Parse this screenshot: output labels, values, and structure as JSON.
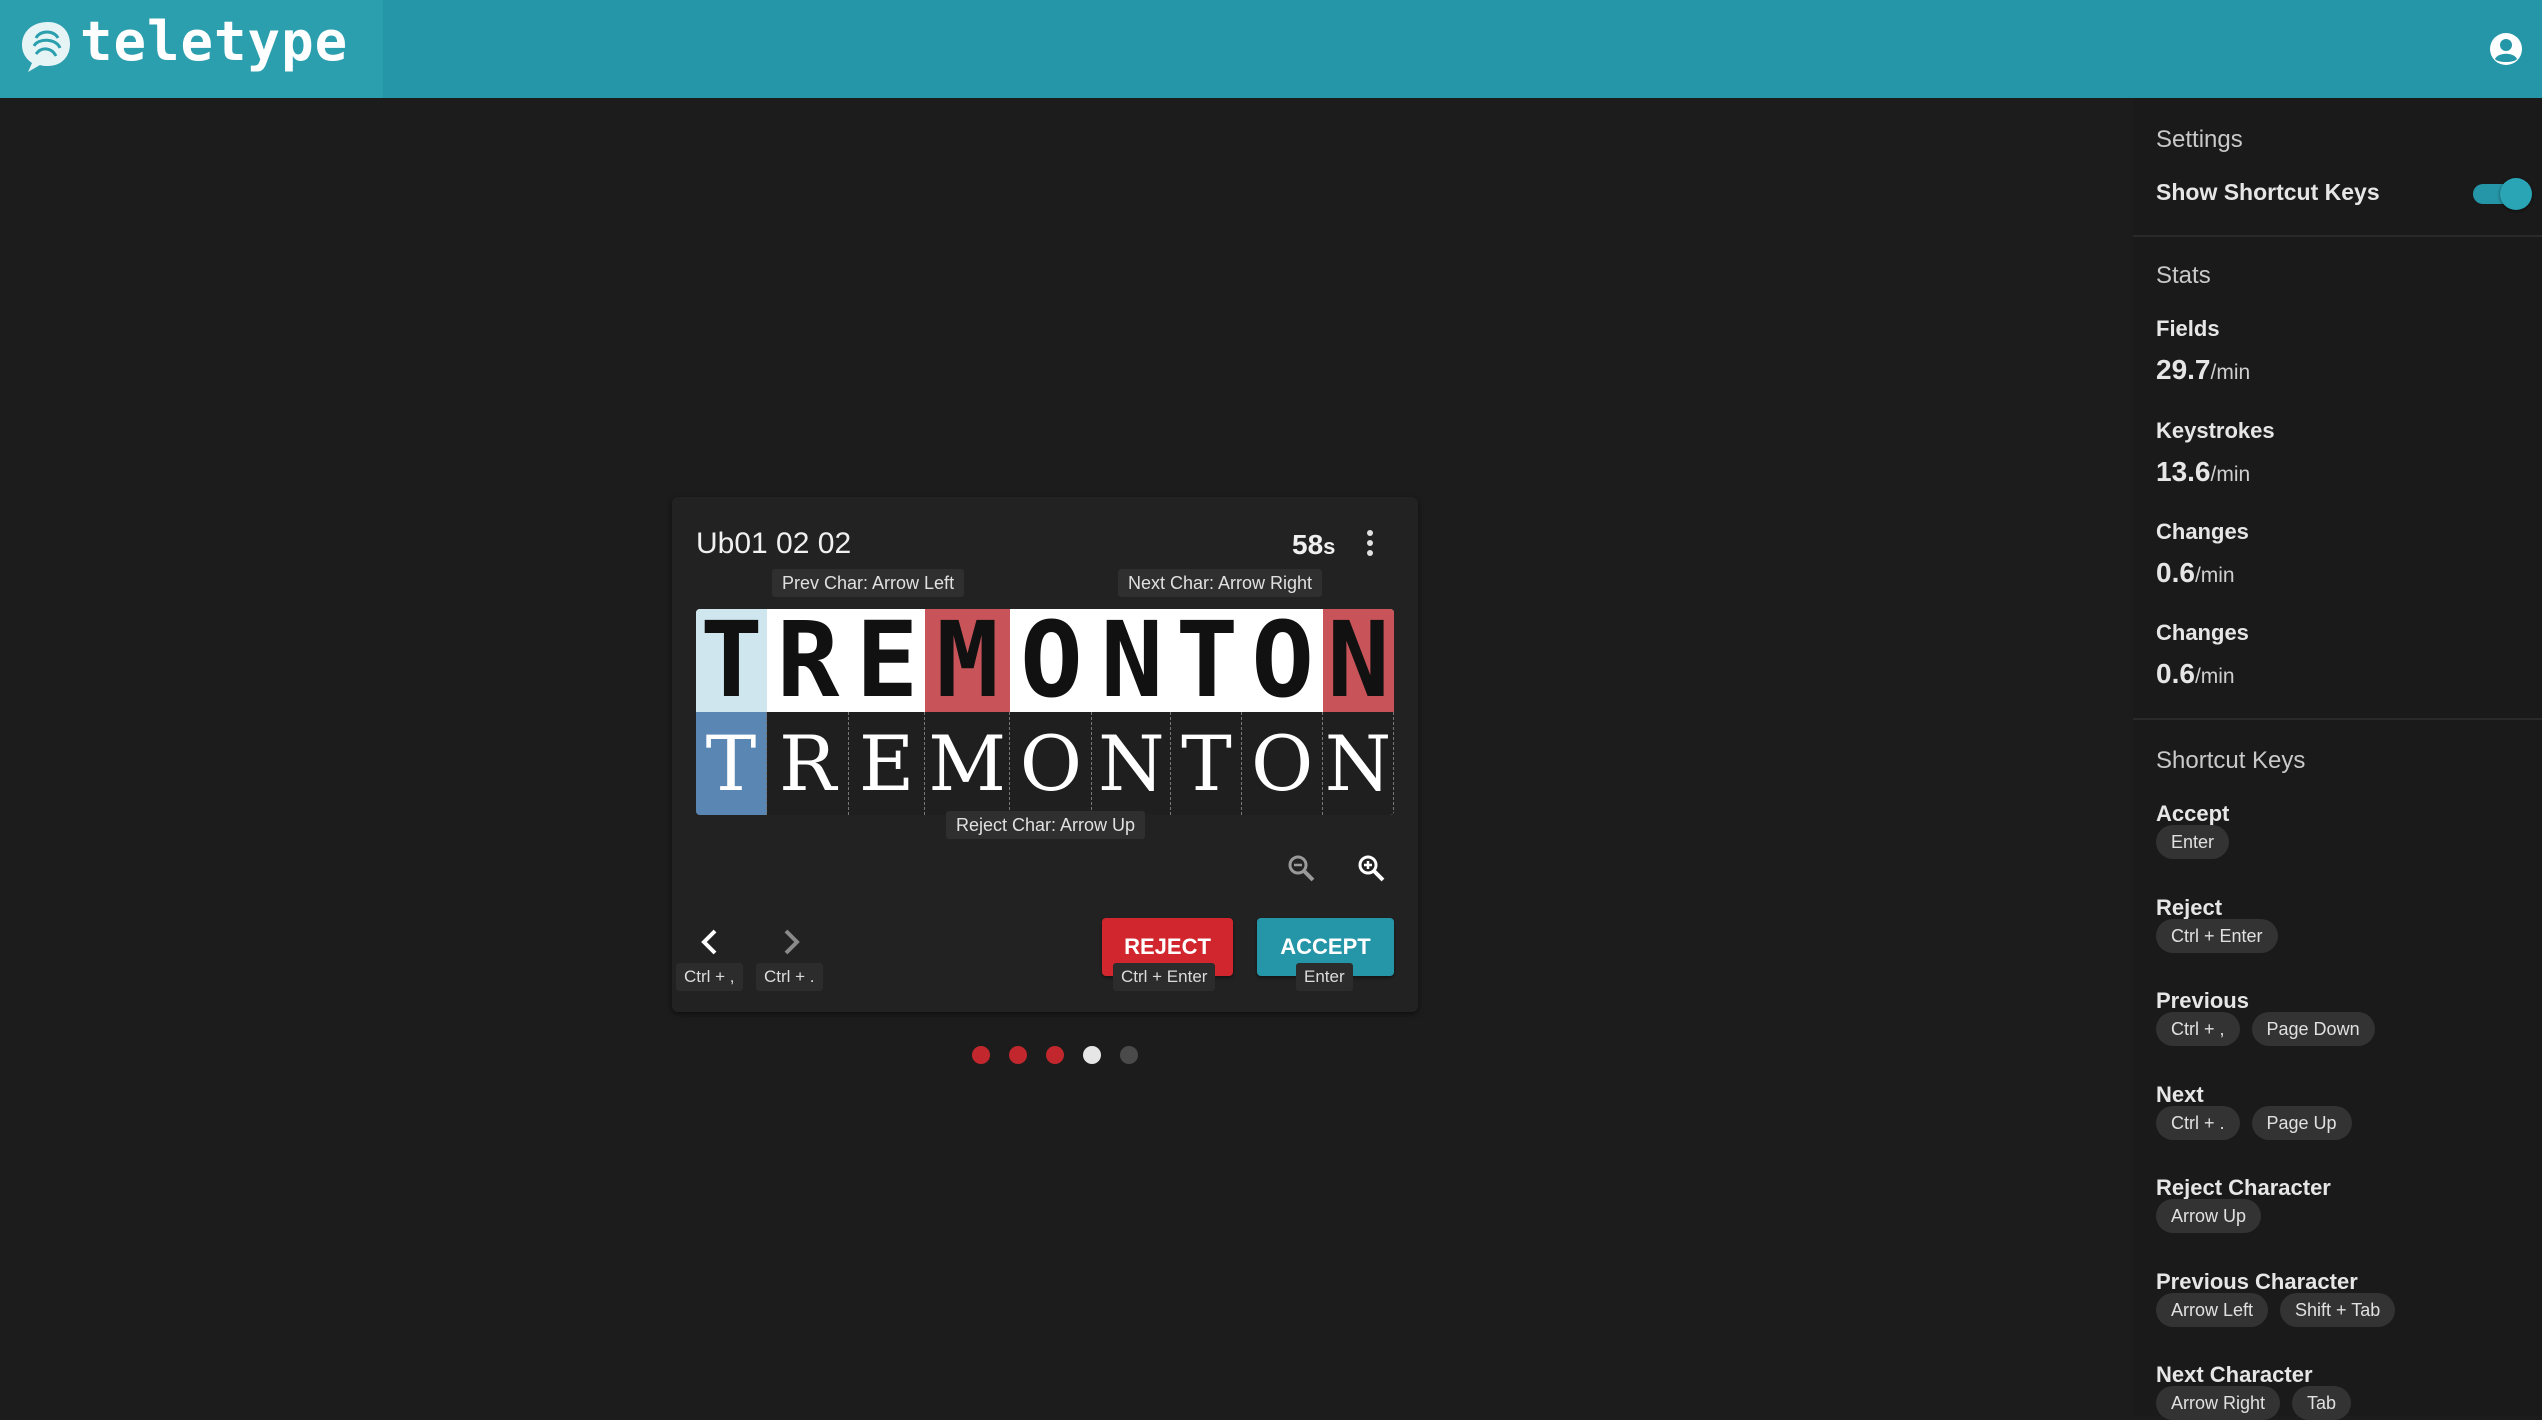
{
  "app": {
    "title": "teletype"
  },
  "settings": {
    "heading": "Settings",
    "show_shortcut_keys_label": "Show Shortcut Keys",
    "show_shortcut_keys_on": true
  },
  "stats": {
    "heading": "Stats",
    "items": [
      {
        "label": "Fields",
        "value": "29.7",
        "unit": "/min"
      },
      {
        "label": "Keystrokes",
        "value": "13.6",
        "unit": "/min"
      },
      {
        "label": "Changes",
        "value": "0.6",
        "unit": "/min"
      },
      {
        "label": "Changes",
        "value": "0.6",
        "unit": "/min"
      }
    ]
  },
  "shortcuts": {
    "heading": "Shortcut Keys",
    "items": [
      {
        "label": "Accept",
        "keys": [
          "Enter"
        ]
      },
      {
        "label": "Reject",
        "keys": [
          "Ctrl + Enter"
        ]
      },
      {
        "label": "Previous",
        "keys": [
          "Ctrl + ,",
          "Page Down"
        ]
      },
      {
        "label": "Next",
        "keys": [
          "Ctrl + .",
          "Page Up"
        ]
      },
      {
        "label": "Reject Character",
        "keys": [
          "Arrow Up"
        ]
      },
      {
        "label": "Previous Character",
        "keys": [
          "Arrow Left",
          "Shift + Tab"
        ]
      },
      {
        "label": "Next Character",
        "keys": [
          "Arrow Right",
          "Tab"
        ]
      }
    ]
  },
  "card": {
    "title": "Ub01 02 02",
    "timer_value": "58",
    "timer_unit": "s",
    "prev_char_tip": "Prev Char: Arrow Left",
    "next_char_tip": "Next Char: Arrow Right",
    "reject_char_tip": "Reject Char: Arrow Up",
    "image_chars": [
      "T",
      "R",
      "E",
      "M",
      "O",
      "N",
      "T",
      "O",
      "N"
    ],
    "typed_chars": [
      "T",
      "R",
      "E",
      "M",
      "O",
      "N",
      "T",
      "O",
      "N"
    ],
    "flagged_indices": [
      3,
      8
    ],
    "selected_index": 0,
    "prev_hint": "Ctrl + ,",
    "next_hint": "Ctrl + .",
    "reject_label": "REJECT",
    "accept_label": "ACCEPT",
    "reject_hint": "Ctrl + Enter",
    "accept_hint": "Enter"
  },
  "pager": {
    "dots": [
      "rejected",
      "rejected",
      "rejected",
      "current",
      "pending"
    ]
  },
  "colors": {
    "header": "#2596a7",
    "accent": "#2596a7",
    "reject": "#d2262e",
    "flag": "#c8545a",
    "selected": "#5a86b3",
    "selected_light": "#cfe6ee"
  },
  "icons": {
    "logo": "teletype-logo-icon",
    "account": "account-circle-icon",
    "menu": "more-vert-icon",
    "zoom_out": "zoom-out-icon",
    "zoom_in": "zoom-in-icon",
    "prev": "chevron-left-icon",
    "next": "chevron-right-icon"
  }
}
